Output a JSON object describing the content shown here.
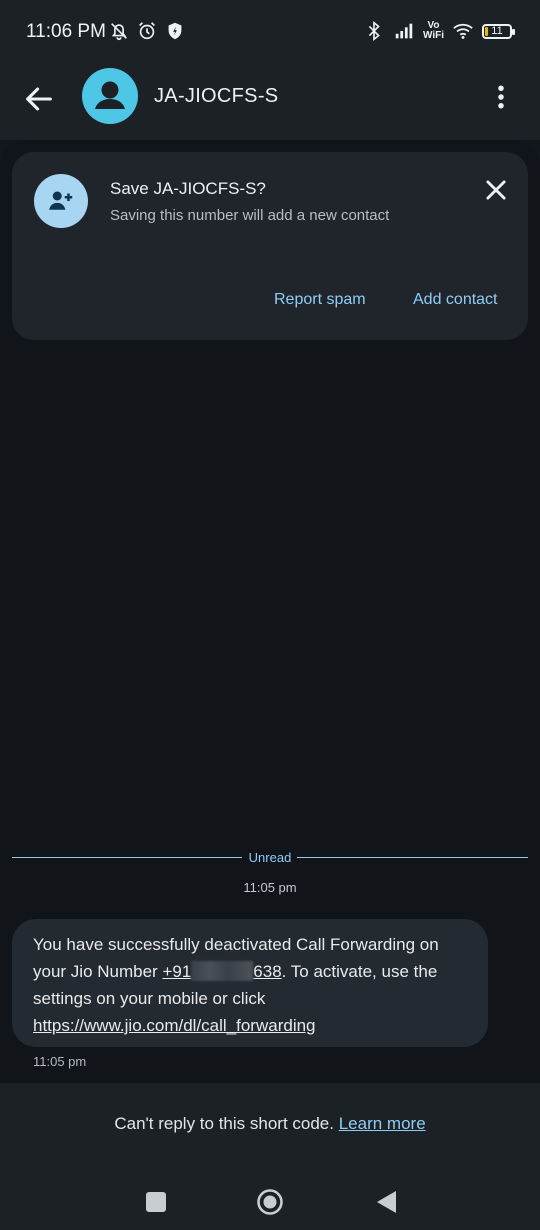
{
  "status_bar": {
    "time": "11:06 PM",
    "left_icons": [
      "mute-bell-icon",
      "alarm-icon",
      "shield-icon"
    ],
    "right_icons": [
      "bluetooth-icon",
      "signal-icon",
      "vowifi-icon",
      "wifi-icon",
      "battery-icon"
    ],
    "vowifi_top": "Vo",
    "vowifi_bottom": "WiFi",
    "battery_level": "11",
    "battery_fraction": 0.11
  },
  "app_bar": {
    "contact_name": "JA-JIOCFS-S",
    "icons": [
      "back-arrow-icon",
      "person-icon",
      "more-vert-icon"
    ]
  },
  "save_card": {
    "title": "Save JA-JIOCFS-S?",
    "subtitle": "Saving this number will add a new contact",
    "report_spam": "Report spam",
    "add_contact": "Add contact",
    "icons": [
      "add-person-icon",
      "close-icon"
    ]
  },
  "thread": {
    "unread_label": "Unread",
    "timestamp": "11:05 pm",
    "message": {
      "text_before": "You have successfully deactivated Call Forwarding on your Jio Number ",
      "number_start": "+91",
      "number_end": "638",
      "text_after": ". To activate, use the settings on your mobile or click ",
      "link": "https://www.jio.com/dl/call_forwarding",
      "time": "11:05 pm"
    }
  },
  "bottom": {
    "cant_reply": "Can't reply to this short code.",
    "learn_more": "Learn more",
    "nav_icons": [
      "recents-square-icon",
      "home-circle-icon",
      "back-triangle-icon"
    ]
  },
  "colors": {
    "background": "#12171d",
    "surface": "#1c2126",
    "card": "#1f252b",
    "bubble": "#242a31",
    "accent": "#8fcdf6",
    "avatar": "#4ec6e6",
    "card_avatar": "#a7d5f2"
  }
}
